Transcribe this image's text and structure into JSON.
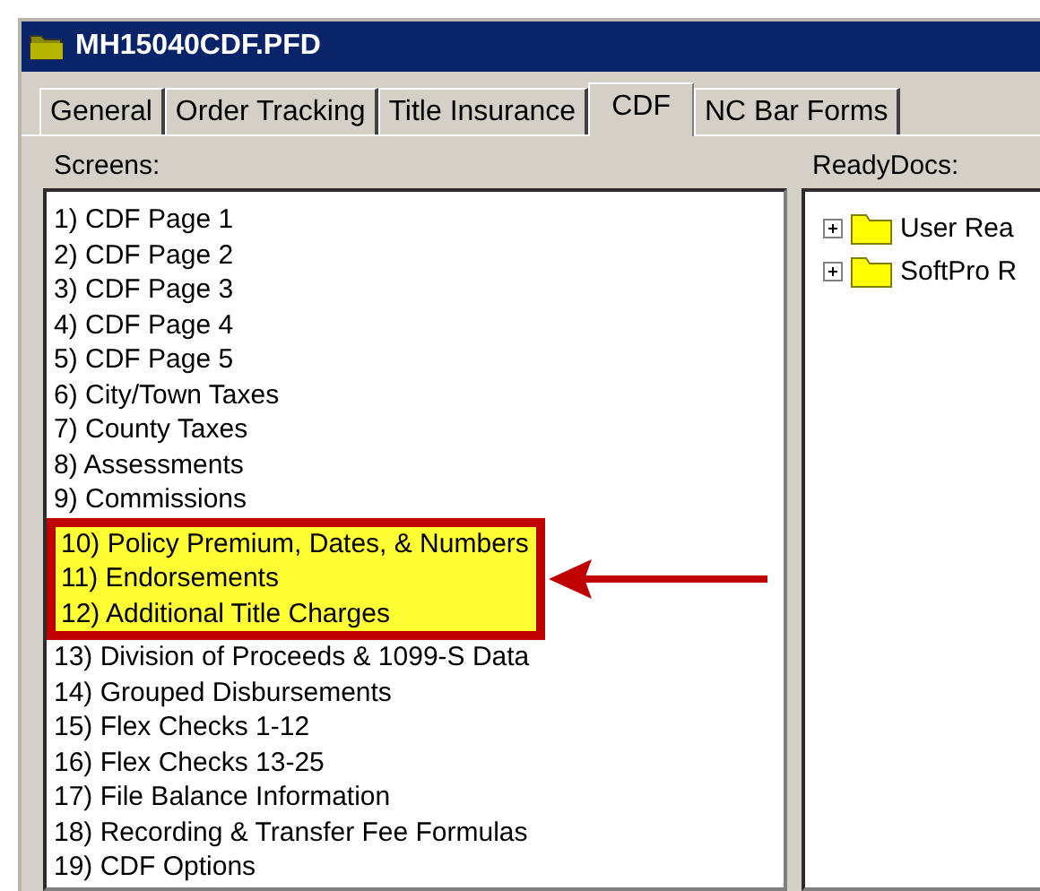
{
  "window": {
    "title": "MH15040CDF.PFD"
  },
  "tabs": [
    {
      "label": "General",
      "selected": false
    },
    {
      "label": "Order Tracking",
      "selected": false
    },
    {
      "label": "Title Insurance",
      "selected": false
    },
    {
      "label": "CDF",
      "selected": true
    },
    {
      "label": "NC Bar Forms",
      "selected": false
    }
  ],
  "screens": {
    "label": "Screens:",
    "items": [
      {
        "text": "1) CDF Page 1",
        "highlighted": false
      },
      {
        "text": "2) CDF Page 2",
        "highlighted": false
      },
      {
        "text": "3) CDF Page 3",
        "highlighted": false
      },
      {
        "text": "4) CDF Page 4",
        "highlighted": false
      },
      {
        "text": "5) CDF Page 5",
        "highlighted": false
      },
      {
        "text": "6) City/Town Taxes",
        "highlighted": false
      },
      {
        "text": "7) County Taxes",
        "highlighted": false
      },
      {
        "text": "8) Assessments",
        "highlighted": false
      },
      {
        "text": "9) Commissions",
        "highlighted": false
      },
      {
        "text": "10) Policy Premium, Dates, & Numbers",
        "highlighted": true
      },
      {
        "text": "11) Endorsements",
        "highlighted": true
      },
      {
        "text": "12) Additional Title Charges",
        "highlighted": true
      },
      {
        "text": "13) Division of Proceeds & 1099-S Data",
        "highlighted": false
      },
      {
        "text": "14) Grouped Disbursements",
        "highlighted": false
      },
      {
        "text": "15) Flex Checks  1-12",
        "highlighted": false
      },
      {
        "text": "16) Flex Checks 13-25",
        "highlighted": false
      },
      {
        "text": "17) File Balance Information",
        "highlighted": false
      },
      {
        "text": "18) Recording & Transfer Fee Formulas",
        "highlighted": false
      },
      {
        "text": "19) CDF Options",
        "highlighted": false
      }
    ]
  },
  "readydocs": {
    "label": "ReadyDocs:",
    "items": [
      {
        "text": "User Rea",
        "expanded": false
      },
      {
        "text": "SoftPro R",
        "expanded": false
      }
    ]
  }
}
